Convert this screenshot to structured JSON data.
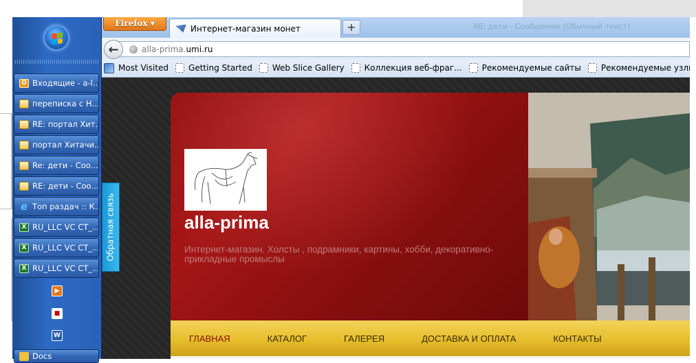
{
  "taskbar": {
    "items": [
      {
        "label": "Входящие - a-l...",
        "icon": "outlook-icon"
      },
      {
        "label": "переписка с Н...",
        "icon": "mail-icon"
      },
      {
        "label": "RE: портал Хит...",
        "icon": "mail-icon"
      },
      {
        "label": "портал Хитачи...",
        "icon": "mail-icon"
      },
      {
        "label": "Re: дети - Соо...",
        "icon": "mail-icon"
      },
      {
        "label": "RE: дети - Соо...",
        "icon": "mail-icon"
      },
      {
        "label": "Топ раздач :: К...",
        "icon": "ie-icon"
      },
      {
        "label": "RU_LLC VC CT_...",
        "icon": "excel-icon"
      },
      {
        "label": "RU_LLC VC CT_...",
        "icon": "excel-icon"
      },
      {
        "label": "RU_LLC VC CT_...",
        "icon": "excel-icon"
      }
    ],
    "quicklaunch": [
      "media-player-icon",
      "floppy-save-icon",
      "word-icon"
    ],
    "docs_label": "Docs"
  },
  "browser": {
    "firefox_menu": "Firefox",
    "tab_title": "Интернет-магазин монет",
    "new_tab": "+",
    "ghost_tab_text": "RE: дети - Сообщение (Обычный текст)",
    "url_prefix": "alla-prima.",
    "url_domain": "umi.ru",
    "bookmarks": [
      "Most Visited",
      "Getting Started",
      "Web Slice Gallery",
      "Коллекция веб-фраг...",
      "Рекомендуемые сайты",
      "Рекомендуемые узлы"
    ]
  },
  "site": {
    "feedback_tab": "Обратная связь",
    "name": "alla-prima",
    "tagline": "Интернет-магазин. Холсты , подрамники, картины, хобби, декоративно-прикладные промыслы",
    "menu": [
      "ГЛАВНАЯ",
      "КАТАЛОГ",
      "ГАЛЕРЕЯ",
      "ДОСТАВКА И ОПЛАТА",
      "КОНТАКТЫ"
    ],
    "active_menu_index": 0
  },
  "colors": {
    "hero_red": "#9a1212",
    "menu_gold": "#e6be2c",
    "menu_active": "#8b0e0e",
    "feedback_blue": "#1a9ad6"
  }
}
